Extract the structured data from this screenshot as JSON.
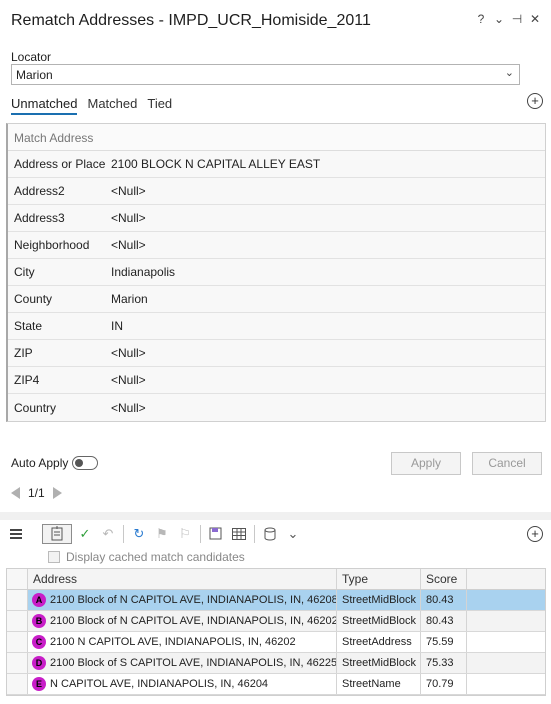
{
  "window": {
    "title": "Rematch Addresses - IMPD_UCR_Homiside_2011",
    "controls": [
      "?",
      "⌄",
      "⊣",
      "✕"
    ]
  },
  "locator": {
    "label": "Locator",
    "value": "Marion"
  },
  "tabs": [
    {
      "label": "Unmatched",
      "active": true
    },
    {
      "label": "Matched",
      "active": false
    },
    {
      "label": "Tied",
      "active": false
    }
  ],
  "match_address": {
    "header": "Match Address",
    "rows": [
      {
        "key": "Address or Place",
        "value": "2100 BLOCK N CAPITAL ALLEY EAST"
      },
      {
        "key": "Address2",
        "value": "<Null>"
      },
      {
        "key": "Address3",
        "value": "<Null>"
      },
      {
        "key": "Neighborhood",
        "value": "<Null>"
      },
      {
        "key": "City",
        "value": "Indianapolis"
      },
      {
        "key": "County",
        "value": "Marion"
      },
      {
        "key": "State",
        "value": "IN"
      },
      {
        "key": "ZIP",
        "value": "<Null>"
      },
      {
        "key": "ZIP4",
        "value": "<Null>"
      },
      {
        "key": "Country",
        "value": "<Null>"
      }
    ]
  },
  "auto_apply": {
    "label": "Auto Apply",
    "on": false
  },
  "buttons": {
    "apply": "Apply",
    "reset": "Cancel"
  },
  "pager": {
    "text": "1/1"
  },
  "cached": {
    "label": "Display cached match candidates",
    "checked": false
  },
  "candidates": {
    "columns": [
      "Address",
      "Type",
      "Score"
    ],
    "rows": [
      {
        "letter": "A",
        "address": "2100 Block of N CAPITOL AVE, INDIANAPOLIS, IN, 46208",
        "type": "StreetMidBlock",
        "score": "80.43",
        "selected": true
      },
      {
        "letter": "B",
        "address": "2100 Block of N CAPITOL AVE, INDIANAPOLIS, IN, 46202",
        "type": "StreetMidBlock",
        "score": "80.43",
        "selected": false
      },
      {
        "letter": "C",
        "address": "2100 N CAPITOL AVE, INDIANAPOLIS, IN, 46202",
        "type": "StreetAddress",
        "score": "75.59",
        "selected": false
      },
      {
        "letter": "D",
        "address": "2100 Block of S CAPITOL AVE, INDIANAPOLIS, IN, 46225",
        "type": "StreetMidBlock",
        "score": "75.33",
        "selected": false
      },
      {
        "letter": "E",
        "address": "N CAPITOL AVE, INDIANAPOLIS, IN, 46204",
        "type": "StreetName",
        "score": "70.79",
        "selected": false
      }
    ]
  },
  "colors": {
    "accent": "#1a6fb0",
    "selected_row": "#a9d2ef",
    "candidate_marker": "#c81ec8"
  }
}
